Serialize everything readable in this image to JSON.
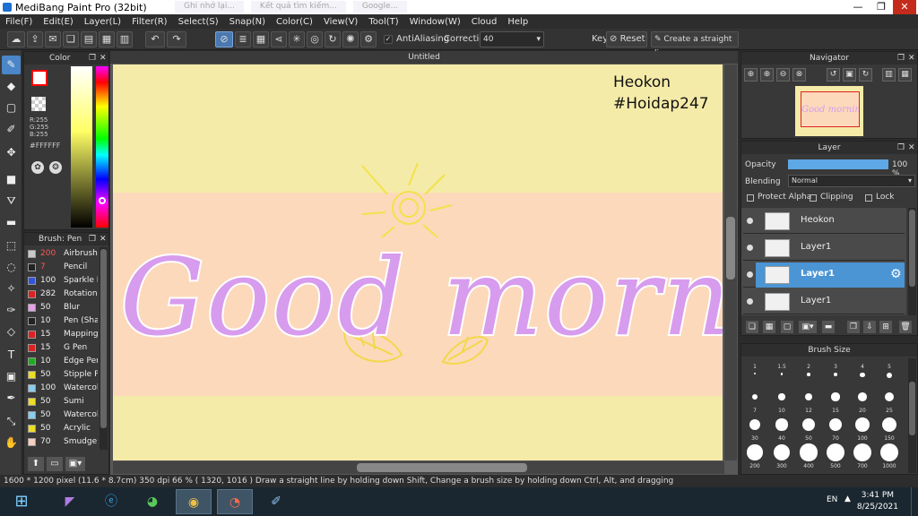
{
  "window": {
    "title": "MediBang Paint Pro (32bit)",
    "controls": [
      "—",
      "❐",
      "✕"
    ],
    "browser_tabs": [
      "Ghi nhớ lại...",
      "Kết quả tìm kiếm...",
      "Google..."
    ]
  },
  "menu": [
    "File(F)",
    "Edit(E)",
    "Layer(L)",
    "Filter(R)",
    "Select(S)",
    "Snap(N)",
    "Color(C)",
    "View(V)",
    "Tool(T)",
    "Window(W)",
    "Cloud",
    "Help"
  ],
  "toolbar": {
    "antialiasing_label": "AntiAliasing",
    "correction_label": "Correction",
    "correction_value": "40",
    "key_label": "Key",
    "reset_label": "Reset",
    "straight_line_label": "Create a straight line"
  },
  "color_panel": {
    "title": "Color",
    "r": "R:255",
    "g": "G:255",
    "b": "B:255",
    "hex": "#FFFFFF",
    "primary_color": "#ffffff",
    "secondary_color": "#ff0000"
  },
  "brush_panel": {
    "title": "Brush: Pen",
    "brushes": [
      {
        "size": "200",
        "name": "Airbrush",
        "color": "#c8c8c8"
      },
      {
        "size": "7",
        "name": "Pencil",
        "color": "#222222"
      },
      {
        "size": "100",
        "name": "Sparkle B",
        "color": "#3355dd"
      },
      {
        "size": "282",
        "name": "Rotation",
        "color": "#dd2222"
      },
      {
        "size": "50",
        "name": "Blur",
        "color": "#e6a0e6"
      },
      {
        "size": "10",
        "name": "Pen (Sha",
        "color": "#222222"
      },
      {
        "size": "15",
        "name": "Mapping",
        "color": "#dd2222"
      },
      {
        "size": "15",
        "name": "G Pen",
        "color": "#dd2222"
      },
      {
        "size": "10",
        "name": "Edge Pen",
        "color": "#22aa22"
      },
      {
        "size": "50",
        "name": "Stipple Pe",
        "color": "#eedd22"
      },
      {
        "size": "100",
        "name": "Watercol",
        "color": "#88ccee"
      },
      {
        "size": "50",
        "name": "Sumi",
        "color": "#eedd22"
      },
      {
        "size": "50",
        "name": "Watercol",
        "color": "#88ccee"
      },
      {
        "size": "50",
        "name": "Acrylic",
        "color": "#eedd22"
      },
      {
        "size": "70",
        "name": "Smudge",
        "color": "#f5d0c0"
      }
    ]
  },
  "canvas": {
    "tab_title": "Untitled",
    "watermark_line1": "Heokon",
    "watermark_line2": "#Hoidap247",
    "main_text": "Good morning",
    "bg_top": "#f5eba8",
    "bg_band": "#fcd9bb",
    "text_color": "#d79cee"
  },
  "navigator": {
    "title": "Navigator",
    "preview_text": "Good morning"
  },
  "layer_panel": {
    "title": "Layer",
    "opacity_label": "Opacity",
    "opacity_value": "100 %",
    "opacity_fraction": 1.0,
    "blending_label": "Blending",
    "blending_value": "Normal",
    "protect_alpha_label": "Protect Alpha",
    "clipping_label": "Clipping",
    "lock_label": "Lock",
    "layers": [
      {
        "name": "Heokon",
        "selected": false
      },
      {
        "name": "Layer1",
        "selected": false
      },
      {
        "name": "Layer1",
        "selected": true
      },
      {
        "name": "Layer1",
        "selected": false
      }
    ]
  },
  "brush_size_panel": {
    "title": "Brush Size",
    "sizes": [
      "1",
      "1.5",
      "2",
      "3",
      "4",
      "5",
      "7",
      "10",
      "12",
      "15",
      "20",
      "25",
      "30",
      "40",
      "50",
      "70",
      "100",
      "150",
      "200",
      "300",
      "400",
      "500",
      "700",
      "1000"
    ]
  },
  "status": {
    "text": "1600 * 1200 pixel   (11.6 * 8.7cm)   350 dpi   66 %   ( 1320, 1016 )   Draw a straight line by holding down Shift, Change a brush size by holding down Ctrl, Alt, and dragging"
  },
  "taskbar": {
    "language": "EN",
    "time": "3:41 PM",
    "date": "8/25/2021"
  }
}
